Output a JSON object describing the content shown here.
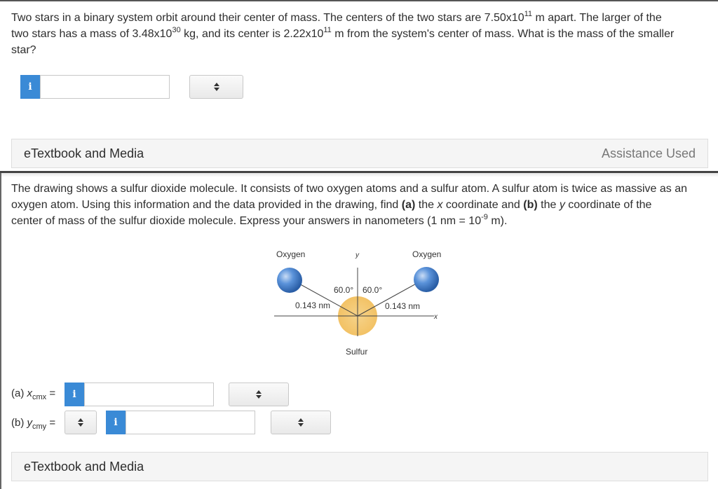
{
  "question1": {
    "text_a": "Two stars in a binary system orbit around their center of mass. The centers of the two stars are 7.50x10",
    "exp_a": "11",
    "text_b": " m apart. The larger of the",
    "text_c": "two stars has a mass of 3.48x10",
    "exp_b": "30",
    "text_d": " kg, and its center is 2.22x10",
    "exp_c": "11",
    "text_e": " m from the system's center of mass. What is the mass of the smaller",
    "text_f": "star?",
    "answer_value": "",
    "info_icon": "i",
    "unit_selected": ""
  },
  "etextbook1": {
    "label": "eTextbook and Media",
    "status": "Assistance Used"
  },
  "question2": {
    "line1": "The drawing shows a sulfur dioxide molecule. It consists of two oxygen atoms and a sulfur atom. A sulfur atom is twice as massive as an",
    "line2_a": "oxygen atom. Using this information and the data provided in the drawing, find ",
    "line2_b": "(a)",
    "line2_c": " the ",
    "line2_d": "x",
    "line2_e": " coordinate and ",
    "line2_f": "(b)",
    "line2_g": " the ",
    "line2_h": "y",
    "line2_i": " coordinate of the",
    "line3_a": "center of mass of the sulfur dioxide molecule. Express your answers in nanometers (1 nm = 10",
    "line3_exp": "-9",
    "line3_b": " m)."
  },
  "diagram": {
    "oxygen_left": "Oxygen",
    "oxygen_right": "Oxygen",
    "y_axis": "y",
    "x_axis": "x",
    "angle_left": "60.0°",
    "angle_right": "60.0°",
    "bond_left": "0.143 nm",
    "bond_right": "0.143 nm",
    "sulfur": "Sulfur",
    "colors": {
      "oxygen": "#3a78c8",
      "sulfur": "#f4c46a"
    }
  },
  "answers": {
    "a_label": "(a) ",
    "a_var": "x",
    "a_sub": "cmx",
    "a_eq": " =",
    "a_value": "",
    "b_label": "(b) ",
    "b_var": "y",
    "b_sub": "cmy",
    "b_eq": " =",
    "b_value": "",
    "info_icon": "i"
  },
  "etextbook2": {
    "label": "eTextbook and Media"
  }
}
